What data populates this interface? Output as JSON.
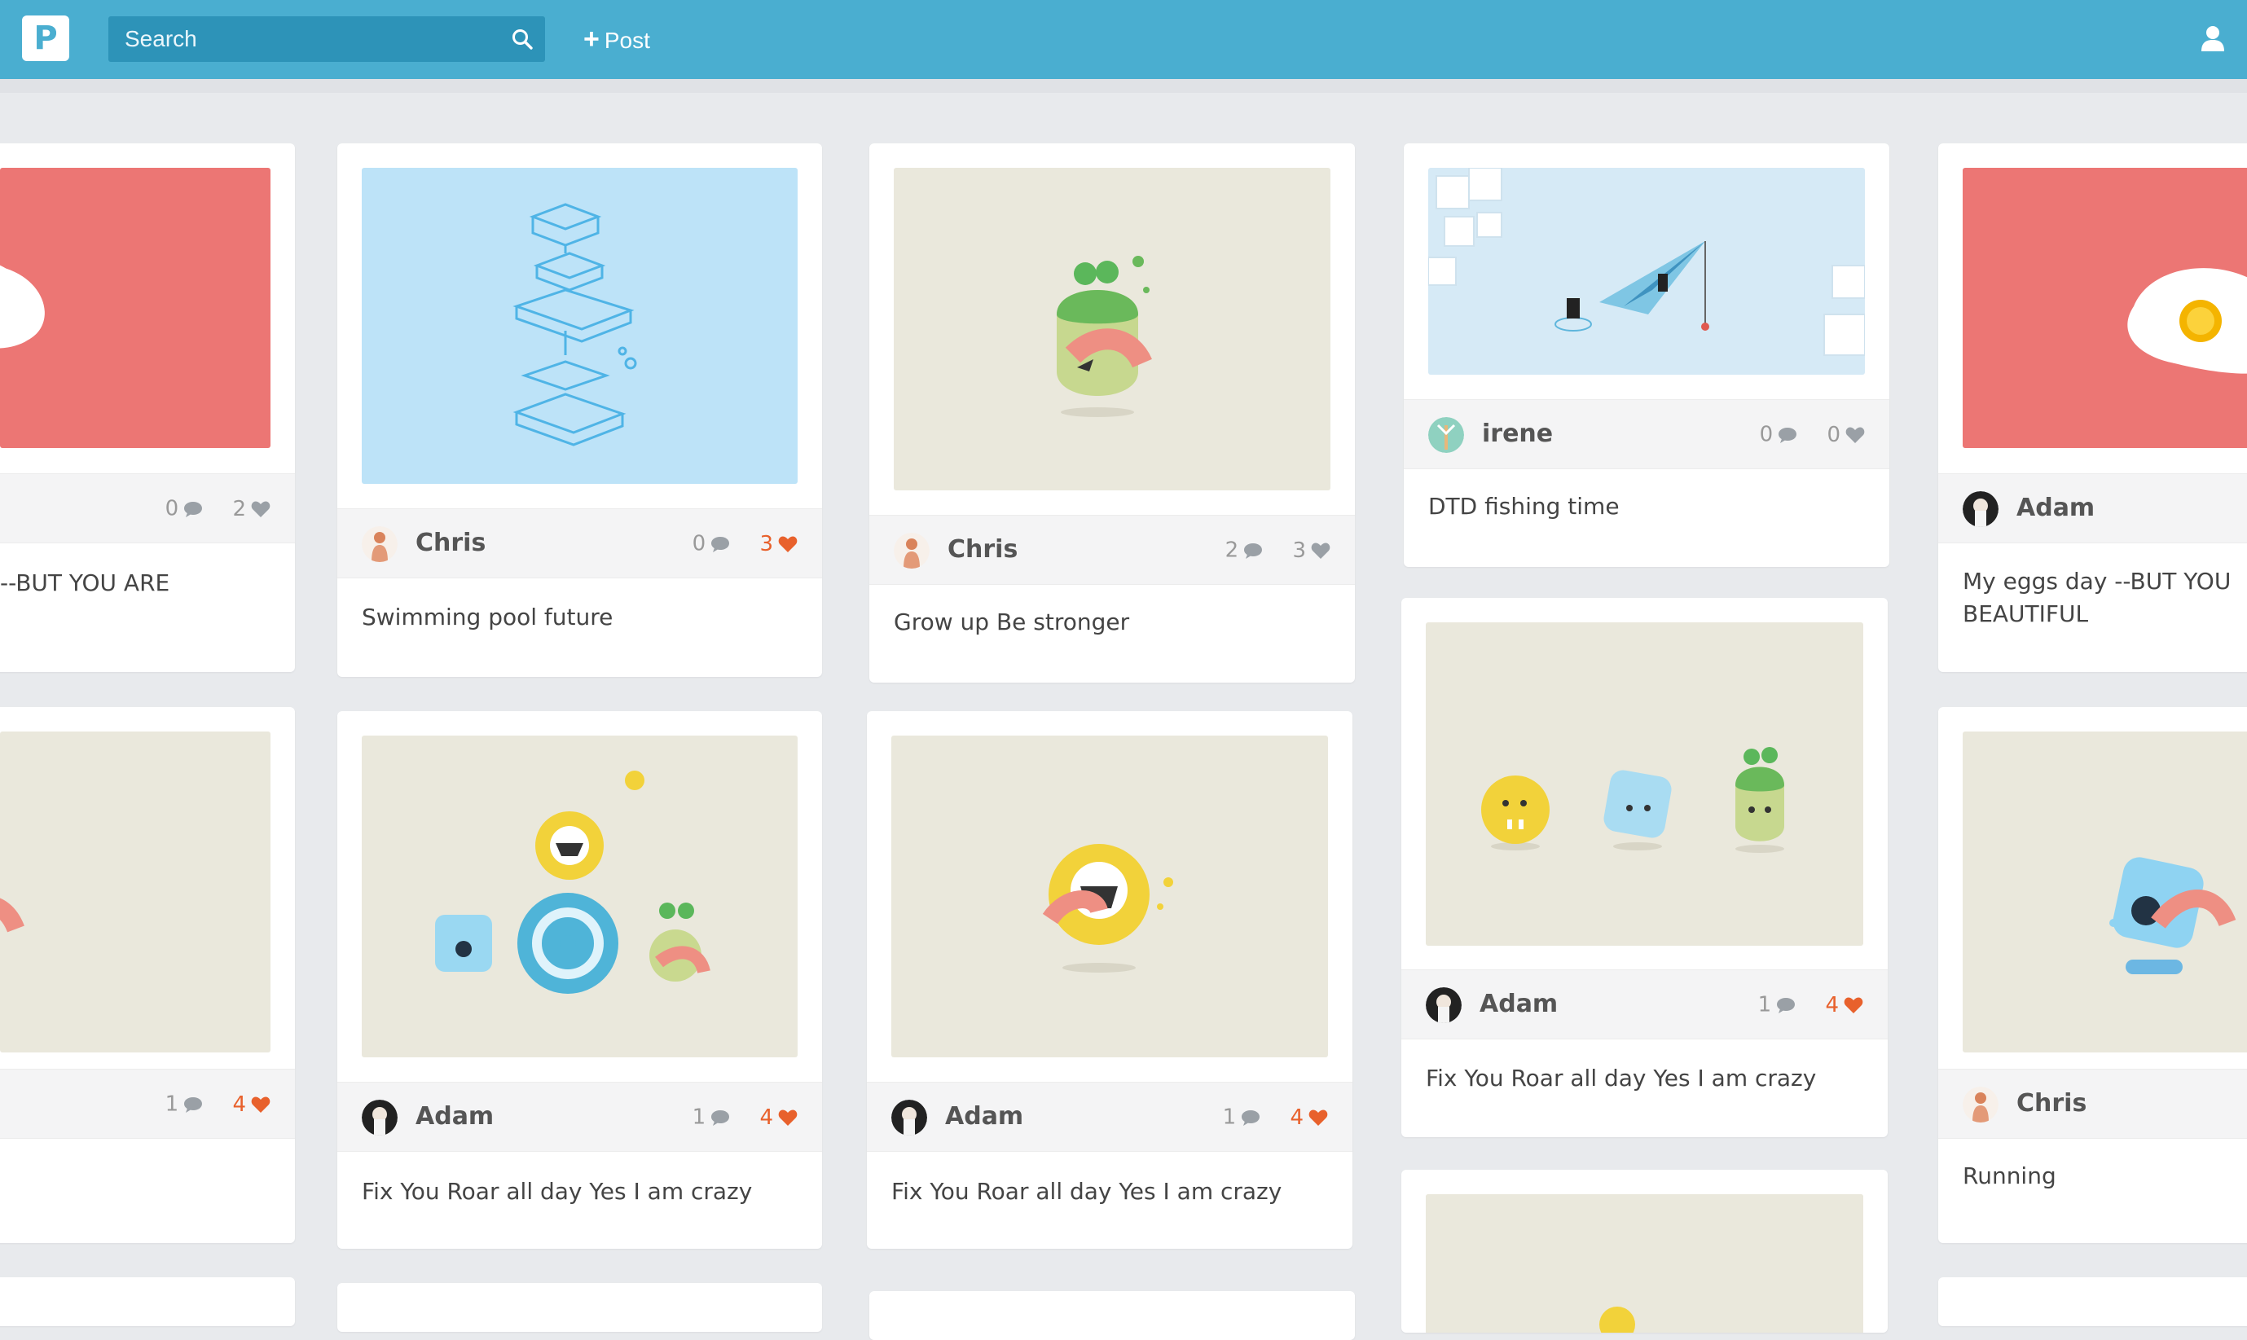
{
  "app": {
    "logo_letter": "P"
  },
  "search": {
    "placeholder": "Search"
  },
  "toolbar": {
    "post_label": "Post"
  },
  "colors": {
    "topbar": "#4aaed0",
    "search_bg": "#2d93b8",
    "like_active": "#e8612c",
    "stat_gray": "#999999"
  },
  "feed": {
    "col0": [
      {
        "comments": "0",
        "likes": "2",
        "caption": "--BUT YOU ARE"
      },
      {
        "comments": "1",
        "likes": "4"
      }
    ],
    "col1": [
      {
        "user": "Chris",
        "comments": "0",
        "likes": "3",
        "caption": "Swimming pool future"
      },
      {
        "user": "Adam",
        "comments": "1",
        "likes": "4",
        "caption": "Fix You Roar all day Yes I am crazy"
      }
    ],
    "col2": [
      {
        "user": "Chris",
        "comments": "2",
        "likes": "3",
        "caption": "Grow up Be stronger"
      },
      {
        "user": "Adam",
        "comments": "1",
        "likes": "4",
        "caption": "Fix You Roar all day Yes I am crazy"
      }
    ],
    "col3": [
      {
        "user": "irene",
        "comments": "0",
        "likes": "0",
        "caption": "DTD fishing time"
      },
      {
        "user": "Adam",
        "comments": "1",
        "likes": "4",
        "caption": "Fix You Roar all day Yes I am crazy"
      }
    ],
    "col4": [
      {
        "user": "Adam",
        "caption": "My eggs day --BUT YOU BEAUTIFUL"
      },
      {
        "user": "Chris",
        "caption": "Running"
      }
    ]
  }
}
